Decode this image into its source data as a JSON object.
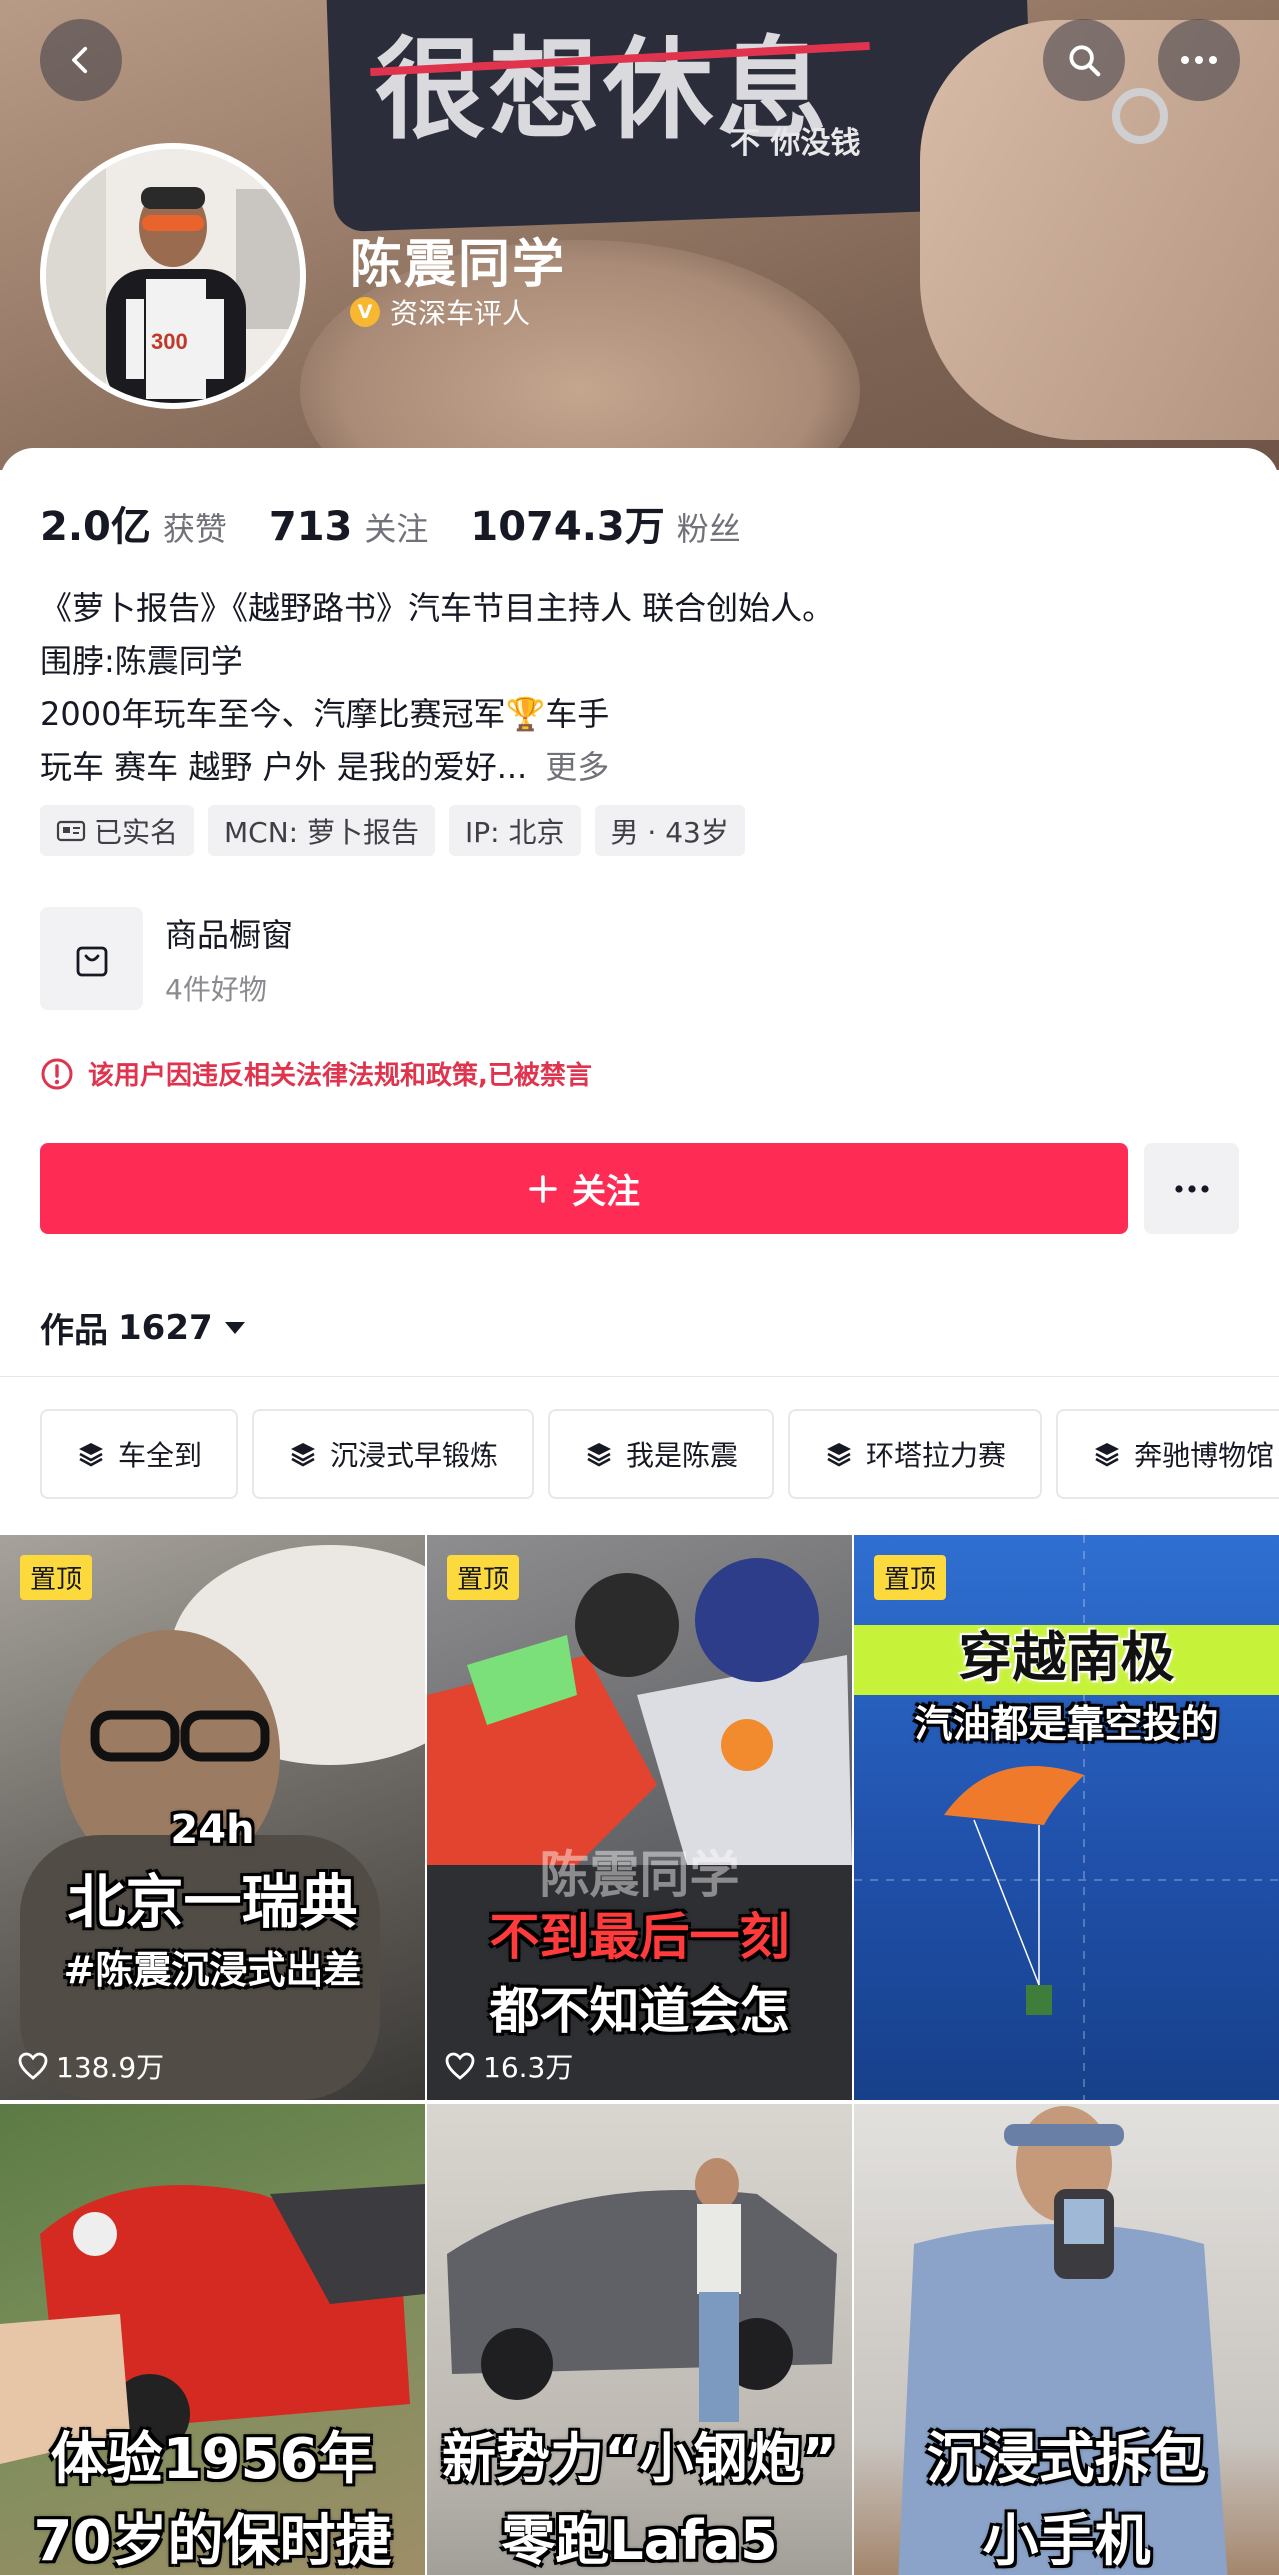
{
  "header": {
    "banner_sign_text": "很想休息",
    "banner_sign_subtext": "不 你没钱",
    "nickname": "陈震同学",
    "verify_badge": "V",
    "verify_label": "资深车评人"
  },
  "stats": [
    {
      "num": "2.0亿",
      "label": "获赞"
    },
    {
      "num": "713",
      "label": "关注"
    },
    {
      "num": "1074.3万",
      "label": "粉丝"
    }
  ],
  "bio": {
    "line1": "《萝卜报告》《越野路书》汽车节目主持人 联合创始人。",
    "line2": "围脖:陈震同学",
    "line3": "2000年玩车至今、汽摩比赛冠军🏆车手",
    "line4": "玩车 赛车 越野 户外 是我的爱好...",
    "more": "更多"
  },
  "tags": [
    "已实名",
    "MCN: 萝卜报告",
    "IP: 北京",
    "男 · 43岁"
  ],
  "shop": {
    "title": "商品橱窗",
    "subtitle": "4件好物"
  },
  "warning": "该用户因违反相关法律法规和政策,已被禁言",
  "follow_label": "关注",
  "works": {
    "label": "作品",
    "count": "1627"
  },
  "collections": [
    "车全到",
    "沉浸式早锻炼",
    "我是陈震",
    "环塔拉力赛",
    "奔驰博物馆"
  ],
  "videos": [
    {
      "pin": "置顶",
      "cap_small": "24h",
      "cap1": "北京一瑞典",
      "cap2": "#陈震沉浸式出差",
      "likes": "138.9万"
    },
    {
      "pin": "置顶",
      "cap_watermark": "陈震同学",
      "cap1": "不到最后一刻",
      "cap2": "都不知道会怎",
      "likes": "16.3万"
    },
    {
      "pin": "置顶",
      "cap1": "穿越南极",
      "cap2": "汽油都是靠空投的"
    },
    {
      "cap1": "体验1956年",
      "cap2": "70岁的保时捷"
    },
    {
      "cap1": "新势力“小钢炮”",
      "cap2": "零跑Lafa5"
    },
    {
      "cap1": "沉浸式拆包",
      "cap2": "小手机"
    }
  ],
  "colors": {
    "accent": "#fe2c55",
    "warning": "#e0344e",
    "pin": "#fcd93d",
    "verify": "#f7b731"
  }
}
